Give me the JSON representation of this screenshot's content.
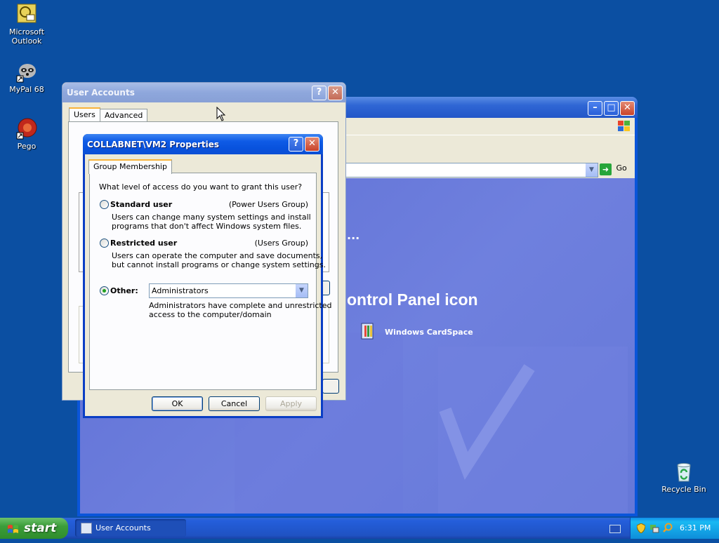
{
  "desktop": {
    "icons": [
      {
        "label": "Microsoft Outlook"
      },
      {
        "label": "MyPal 68"
      },
      {
        "label": "Pego"
      },
      {
        "label": "Recycle Bin"
      }
    ]
  },
  "control_panel_window": {
    "go_label": "Go",
    "ellipsis": "...",
    "heading": "ontrol Panel icon",
    "cardspace_label": "Windows CardSpace"
  },
  "user_accounts": {
    "title": "User Accounts",
    "tabs": [
      "Users",
      "Advanced"
    ]
  },
  "properties_dialog": {
    "title": "COLLABNET\\VM2 Properties",
    "tab": "Group Membership",
    "question": "What level of access do you want to grant this user?",
    "options": [
      {
        "label": "Standard user",
        "group": "(Power Users Group)",
        "desc1": "Users can change many system settings and install",
        "desc2": "programs that don't affect Windows system files.",
        "selected": false
      },
      {
        "label": "Restricted user",
        "group": "(Users Group)",
        "desc1": "Users can operate the computer and save documents,",
        "desc2": "but cannot install programs or change system settings.",
        "selected": false
      },
      {
        "label": "Other:",
        "selected": true
      }
    ],
    "other_select_value": "Administrators",
    "other_desc1": "Administrators have complete and unrestricted",
    "other_desc2": "access to the computer/domain",
    "buttons": {
      "ok": "OK",
      "cancel": "Cancel",
      "apply": "Apply"
    }
  },
  "taskbar": {
    "start_label": "start",
    "task_label": "User Accounts",
    "clock": "6:31 PM"
  }
}
